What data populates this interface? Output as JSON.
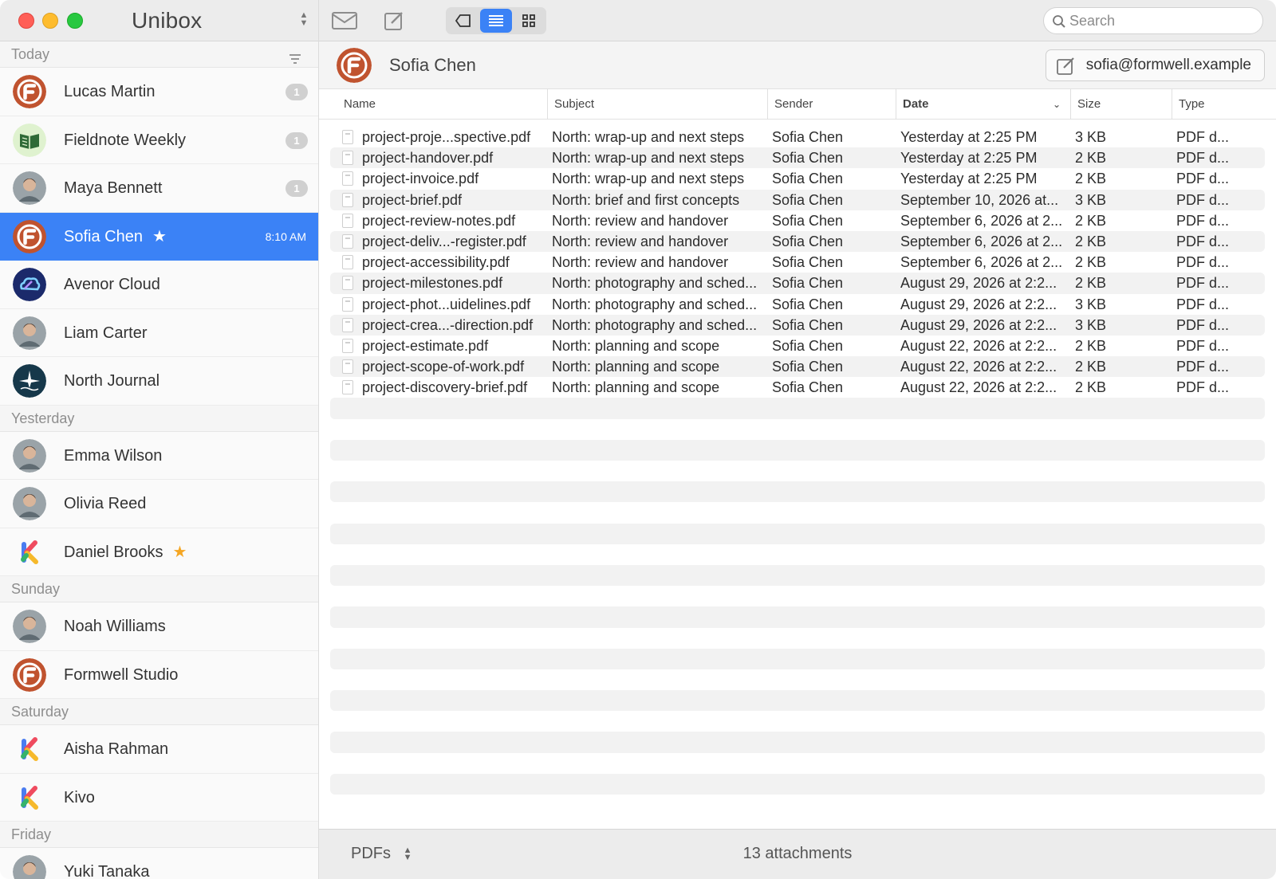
{
  "app": {
    "title": "Unibox"
  },
  "colors": {
    "accent": "#3b82f6",
    "formwell": "#c0532f",
    "badge": "#d0d0d0",
    "star": "#f5a623"
  },
  "sidebar": {
    "sections": [
      {
        "label": "Today",
        "items": [
          {
            "name": "Lucas Martin",
            "avatar": "formwell-logo",
            "badge": "1"
          },
          {
            "name": "Fieldnote Weekly",
            "avatar": "book-logo",
            "badge": "1"
          },
          {
            "name": "Maya Bennett",
            "avatar": "photo",
            "badge": "1"
          },
          {
            "name": "Sofia Chen",
            "avatar": "formwell-logo",
            "starred": true,
            "time": "8:10 AM",
            "selected": true
          },
          {
            "name": "Avenor Cloud",
            "avatar": "cloud-logo"
          },
          {
            "name": "Liam Carter",
            "avatar": "photo"
          },
          {
            "name": "North Journal",
            "avatar": "compass-logo"
          }
        ]
      },
      {
        "label": "Yesterday",
        "items": [
          {
            "name": "Emma Wilson",
            "avatar": "photo"
          },
          {
            "name": "Olivia Reed",
            "avatar": "photo"
          },
          {
            "name": "Daniel Brooks",
            "avatar": "kivo-logo",
            "starred": true
          }
        ]
      },
      {
        "label": "Sunday",
        "items": [
          {
            "name": "Noah Williams",
            "avatar": "photo"
          },
          {
            "name": "Formwell Studio",
            "avatar": "formwell-logo"
          }
        ]
      },
      {
        "label": "Saturday",
        "items": [
          {
            "name": "Aisha Rahman",
            "avatar": "kivo-logo"
          },
          {
            "name": "Kivo",
            "avatar": "kivo-logo"
          }
        ]
      },
      {
        "label": "Friday",
        "items": [
          {
            "name": "Yuki Tanaka",
            "avatar": "photo"
          }
        ]
      }
    ]
  },
  "toolbar": {
    "icons": [
      "mailbox-icon",
      "compose-icon",
      "back-icon",
      "list-view-icon",
      "grid-view-icon"
    ],
    "search_placeholder": "Search"
  },
  "contact": {
    "name": "Sofia Chen",
    "email": "sofia@formwell.example"
  },
  "table": {
    "columns": [
      "Name",
      "Subject",
      "Sender",
      "Date",
      "Size",
      "Type"
    ],
    "sort_column": "Date",
    "rows": [
      [
        "project-proje...spective.pdf",
        "North: wrap-up and next steps",
        "Sofia Chen",
        "Yesterday at 2:25 PM",
        "3 KB",
        "PDF d..."
      ],
      [
        "project-handover.pdf",
        "North: wrap-up and next steps",
        "Sofia Chen",
        "Yesterday at 2:25 PM",
        "2 KB",
        "PDF d..."
      ],
      [
        "project-invoice.pdf",
        "North: wrap-up and next steps",
        "Sofia Chen",
        "Yesterday at 2:25 PM",
        "2 KB",
        "PDF d..."
      ],
      [
        "project-brief.pdf",
        "North: brief and first concepts",
        "Sofia Chen",
        "September 10, 2026 at...",
        "3 KB",
        "PDF d..."
      ],
      [
        "project-review-notes.pdf",
        "North: review and handover",
        "Sofia Chen",
        "September 6, 2026 at 2...",
        "2 KB",
        "PDF d..."
      ],
      [
        "project-deliv...-register.pdf",
        "North: review and handover",
        "Sofia Chen",
        "September 6, 2026 at 2...",
        "2 KB",
        "PDF d..."
      ],
      [
        "project-accessibility.pdf",
        "North: review and handover",
        "Sofia Chen",
        "September 6, 2026 at 2...",
        "2 KB",
        "PDF d..."
      ],
      [
        "project-milestones.pdf",
        "North: photography and sched...",
        "Sofia Chen",
        "August 29, 2026 at 2:2...",
        "2 KB",
        "PDF d..."
      ],
      [
        "project-phot...uidelines.pdf",
        "North: photography and sched...",
        "Sofia Chen",
        "August 29, 2026 at 2:2...",
        "3 KB",
        "PDF d..."
      ],
      [
        "project-crea...-direction.pdf",
        "North: photography and sched...",
        "Sofia Chen",
        "August 29, 2026 at 2:2...",
        "3 KB",
        "PDF d..."
      ],
      [
        "project-estimate.pdf",
        "North: planning and scope",
        "Sofia Chen",
        "August 22, 2026 at 2:2...",
        "2 KB",
        "PDF d..."
      ],
      [
        "project-scope-of-work.pdf",
        "North: planning and scope",
        "Sofia Chen",
        "August 22, 2026 at 2:2...",
        "2 KB",
        "PDF d..."
      ],
      [
        "project-discovery-brief.pdf",
        "North: planning and scope",
        "Sofia Chen",
        "August 22, 2026 at 2:2...",
        "2 KB",
        "PDF d..."
      ]
    ]
  },
  "footer": {
    "filter": "PDFs",
    "count": "13 attachments"
  }
}
